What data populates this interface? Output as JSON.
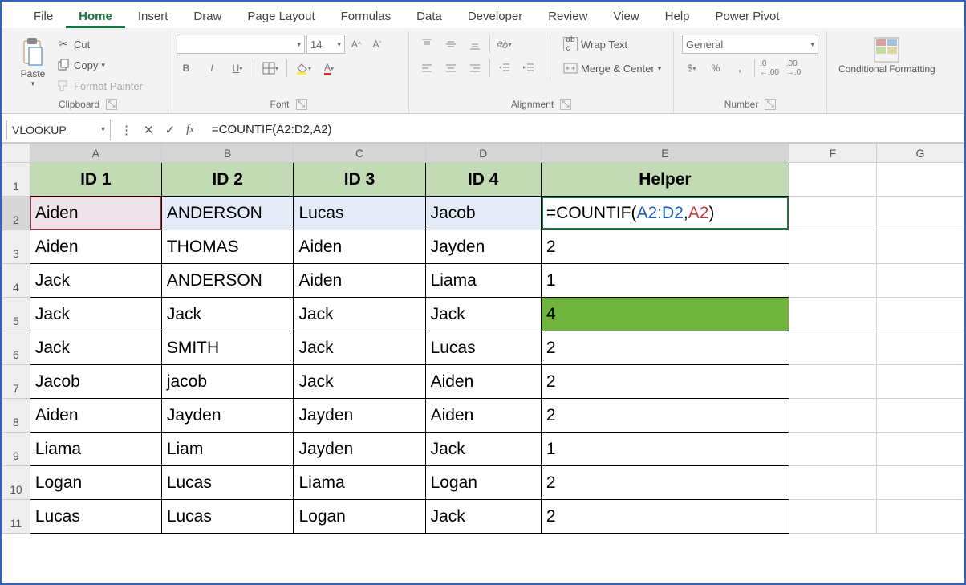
{
  "menu": {
    "tabs": [
      "File",
      "Home",
      "Insert",
      "Draw",
      "Page Layout",
      "Formulas",
      "Data",
      "Developer",
      "Review",
      "View",
      "Help",
      "Power Pivot"
    ],
    "activeIndex": 1
  },
  "ribbon": {
    "clipboard": {
      "label": "Clipboard",
      "paste": "Paste",
      "cut": "Cut",
      "copy": "Copy",
      "painter": "Format Painter"
    },
    "font": {
      "label": "Font",
      "size": "14"
    },
    "alignment": {
      "label": "Alignment",
      "wrap": "Wrap Text",
      "merge": "Merge & Center"
    },
    "number": {
      "label": "Number",
      "format": "General"
    },
    "cond": "Conditional Formatting"
  },
  "formulaBar": {
    "name": "VLOOKUP",
    "formula": "=COUNTIF(A2:D2,A2)"
  },
  "grid": {
    "columns": [
      "A",
      "B",
      "C",
      "D",
      "E",
      "F",
      "G"
    ],
    "headers": [
      "ID 1",
      "ID 2",
      "ID 3",
      "ID 4",
      "Helper"
    ],
    "activeCellFormula": {
      "prefix": "=COUNTIF(",
      "range": "A2:D2",
      "comma": ",",
      "ref": "A2",
      "suffix": ")"
    },
    "rows": [
      {
        "n": 2,
        "c": [
          "Aiden",
          "ANDERSON",
          "Lucas",
          "Jacob",
          ""
        ]
      },
      {
        "n": 3,
        "c": [
          "Aiden",
          "THOMAS",
          "Aiden",
          "Jayden",
          "2"
        ]
      },
      {
        "n": 4,
        "c": [
          "Jack",
          "ANDERSON",
          "Aiden",
          "Liama",
          "1"
        ]
      },
      {
        "n": 5,
        "c": [
          "Jack",
          "Jack",
          "Jack",
          "Jack",
          "4"
        ]
      },
      {
        "n": 6,
        "c": [
          "Jack",
          "SMITH",
          "Jack",
          "Lucas",
          "2"
        ]
      },
      {
        "n": 7,
        "c": [
          "Jacob",
          "jacob",
          "Jack",
          "Aiden",
          "2"
        ]
      },
      {
        "n": 8,
        "c": [
          "Aiden",
          "Jayden",
          "Jayden",
          "Aiden",
          "2"
        ]
      },
      {
        "n": 9,
        "c": [
          "Liama",
          "Liam",
          "Jayden",
          "Jack",
          "1"
        ]
      },
      {
        "n": 10,
        "c": [
          "Logan",
          "Lucas",
          "Liama",
          "Logan",
          "2"
        ]
      },
      {
        "n": 11,
        "c": [
          "Lucas",
          "Lucas",
          "Logan",
          "Jack",
          "2"
        ]
      }
    ],
    "highlightGreenRow": 5
  }
}
